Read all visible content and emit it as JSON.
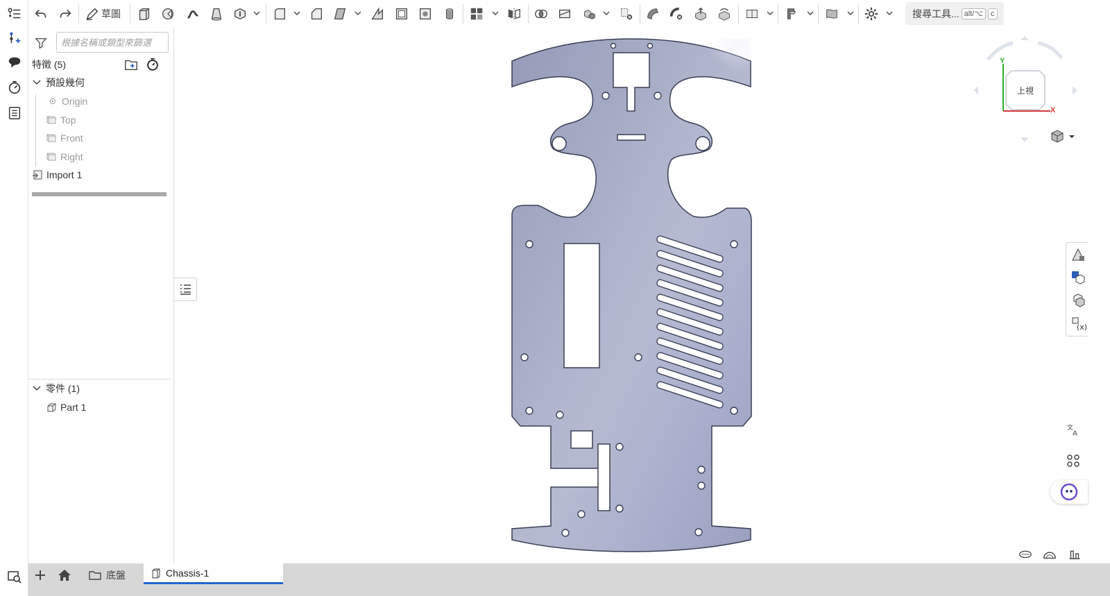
{
  "toolbar": {
    "sketch_label": "草圖",
    "search_label": "搜尋工具...",
    "search_kbd1": "alt/⌥",
    "search_kbd2": "c"
  },
  "feature_panel": {
    "filter_placeholder": "根據名稱或類型來篩選",
    "features_header": "特徵 (5)",
    "default_geometry": "預設幾何",
    "items": [
      "Origin",
      "Top",
      "Front",
      "Right"
    ],
    "import": "Import 1",
    "parts_header": "零件 (1)",
    "part": "Part 1"
  },
  "view_cube": {
    "face_label": "上視",
    "axis_y": "Y",
    "axis_x": "X"
  },
  "bottom": {
    "folder_label": "底盤",
    "document_tab": "Chassis-1"
  },
  "colors": {
    "part_fill_light": "#c9ccdf",
    "part_fill_dark": "#9da3c0",
    "outline": "#3a3f55",
    "accent": "#2266cc"
  }
}
